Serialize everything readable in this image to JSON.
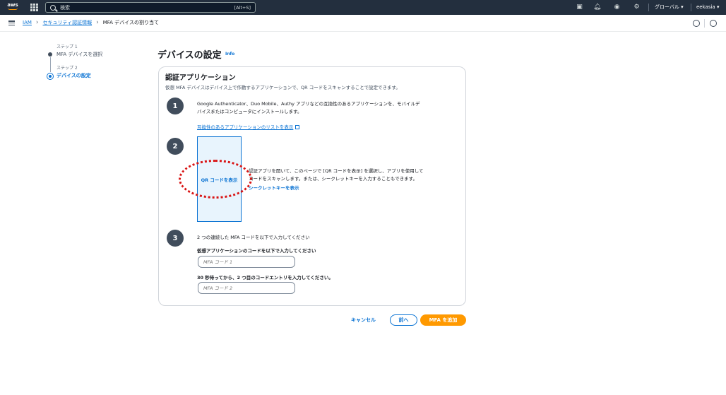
{
  "topnav": {
    "logo_text": "aws",
    "search_placeholder": "検索",
    "search_hint": "[Alt+S]",
    "region": "グローバル ▾",
    "account": "eekasia ▾"
  },
  "breadcrumb": {
    "items": [
      "IAM",
      "セキュリティ認証情報",
      "MFA デバイスの割り当て"
    ]
  },
  "steps": [
    {
      "label": "ステップ 1",
      "name": "MFA デバイスを選択"
    },
    {
      "label": "ステップ 2",
      "name": "デバイスの設定"
    }
  ],
  "header": {
    "title": "デバイスの設定",
    "info": "Info"
  },
  "panel": {
    "title": "認証アプリケーション",
    "description": "仮想 MFA デバイスはデバイス上で作動するアプリケーションで、QR コードをスキャンすることで設定できます。",
    "step1": {
      "number": "1",
      "text_line1": "Google Authenticator、Duo Mobile、Authy アプリなどの互換性のあるアプリケーションを、モバイルデ",
      "text_line2": "バイスまたはコンピュータにインストールします。",
      "link": "互換性のあるアプリケーションのリストを表示"
    },
    "step2": {
      "number": "2",
      "qr_button": "QR コードを表示",
      "text_line1": "認証アプリを開いて、このページで [QR コードを表示] を選択し、アプリを使用して",
      "text_line2": "コードをスキャンします。または、シークレットキーを入力することもできます。",
      "secret_link": "シークレットキーを表示"
    },
    "step3": {
      "number": "3",
      "intro": "2 つの連続した MFA コードを以下で入力してください",
      "code1_label": "仮想アプリケーションのコードを以下で入力してください",
      "code1_placeholder": "MFA コード 1",
      "code2_label": "30 秒待ってから、2 つ目のコードエントリを入力してください。",
      "code2_placeholder": "MFA コード 2"
    }
  },
  "footer": {
    "cancel": "キャンセル",
    "previous": "前へ",
    "add": "MFA を追加"
  },
  "colors": {
    "nav_bg": "#232f3e",
    "link": "#0972d3",
    "primary": "#ff9900",
    "highlight": "#d91515"
  }
}
